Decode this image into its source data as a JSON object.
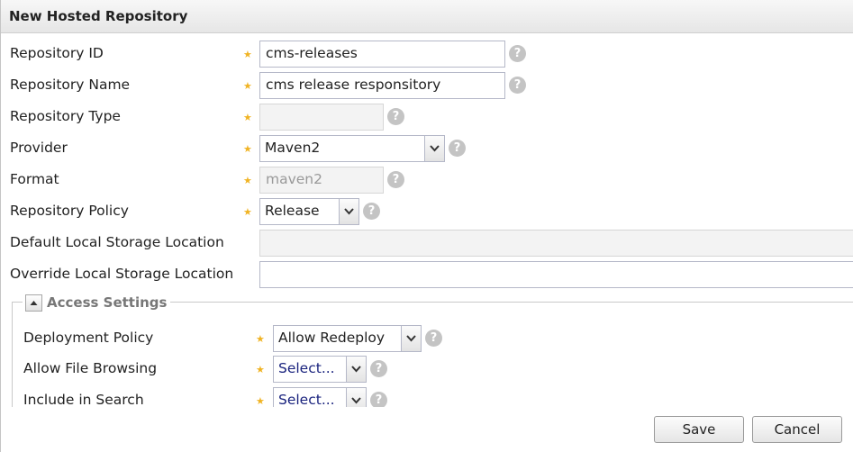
{
  "dialog": {
    "title": "New Hosted Repository"
  },
  "form": {
    "repository_id": {
      "label": "Repository ID",
      "value": "cms-releases"
    },
    "repository_name": {
      "label": "Repository Name",
      "value": "cms release responsitory"
    },
    "repository_type": {
      "label": "Repository Type",
      "value": ""
    },
    "provider": {
      "label": "Provider",
      "value": "Maven2"
    },
    "format": {
      "label": "Format",
      "value": "maven2"
    },
    "repository_policy": {
      "label": "Repository Policy",
      "value": "Release"
    },
    "default_storage": {
      "label": "Default Local Storage Location",
      "value": ""
    },
    "override_storage": {
      "label": "Override Local Storage Location",
      "value": ""
    }
  },
  "access_settings": {
    "legend": "Access Settings",
    "deployment_policy": {
      "label": "Deployment Policy",
      "value": "Allow Redeploy"
    },
    "allow_file_browsing": {
      "label": "Allow File Browsing",
      "value": "Select..."
    },
    "include_in_search": {
      "label": "Include in Search",
      "value": "Select..."
    }
  },
  "buttons": {
    "save": "Save",
    "cancel": "Cancel"
  },
  "icons": {
    "required": "star-icon",
    "help": "question-icon",
    "dropdown": "chevron-down-icon",
    "collapse": "chevron-up-icon"
  },
  "colors": {
    "required_star": "#f0b323",
    "help_icon": "#c4c4c4",
    "placeholder_text": "#1a237e"
  }
}
